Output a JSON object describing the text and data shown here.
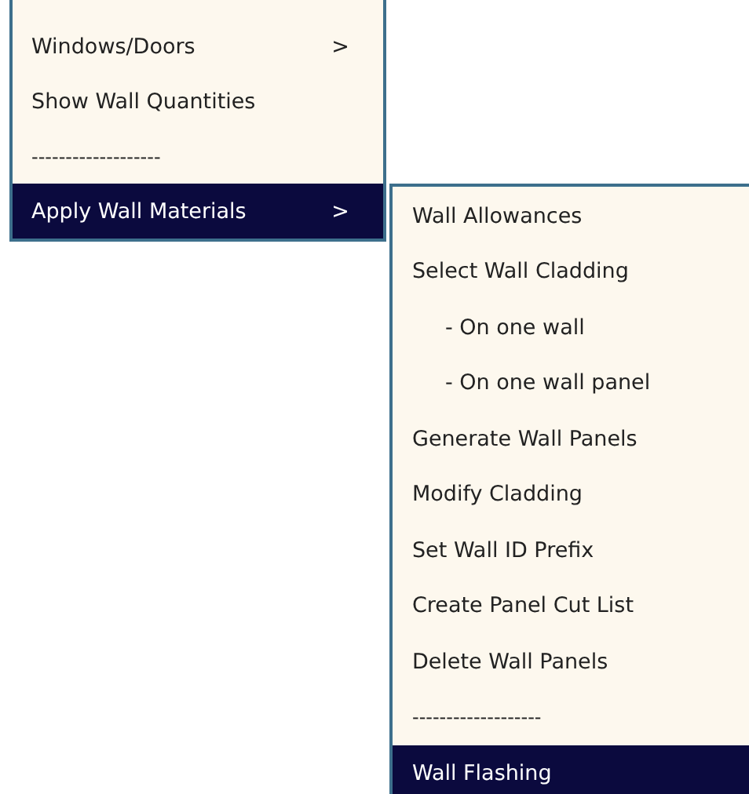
{
  "menu": {
    "items": [
      {
        "kind": "item",
        "label": "Windows/Doors",
        "arrow": ">",
        "selected": false
      },
      {
        "kind": "item",
        "label": "Show Wall Quantities",
        "selected": false
      },
      {
        "kind": "separator",
        "label": "-------------------",
        "selected": false
      },
      {
        "kind": "item",
        "label": "Apply Wall Materials",
        "arrow": ">",
        "selected": true
      }
    ]
  },
  "submenu": {
    "items": [
      {
        "kind": "item",
        "label": "Wall Allowances",
        "selected": false
      },
      {
        "kind": "item",
        "label": "Select Wall Cladding",
        "selected": false
      },
      {
        "kind": "subitem",
        "label": "- On one wall",
        "selected": false
      },
      {
        "kind": "subitem",
        "label": "- On one wall panel",
        "selected": false
      },
      {
        "kind": "item",
        "label": "Generate Wall Panels",
        "selected": false
      },
      {
        "kind": "item",
        "label": "Modify Cladding",
        "selected": false
      },
      {
        "kind": "item",
        "label": "Set Wall ID Prefix",
        "selected": false
      },
      {
        "kind": "item",
        "label": "Create Panel Cut List",
        "selected": false
      },
      {
        "kind": "item",
        "label": "Delete Wall Panels",
        "selected": false
      },
      {
        "kind": "separator",
        "label": "-------------------",
        "selected": false
      },
      {
        "kind": "item",
        "label": "Wall Flashing",
        "selected": true
      }
    ]
  }
}
